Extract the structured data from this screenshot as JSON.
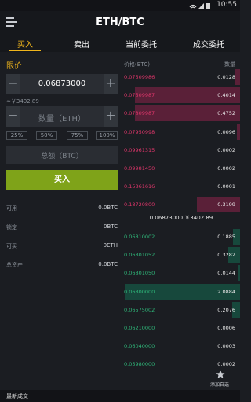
{
  "status": {
    "time": "10:55"
  },
  "header": {
    "title": "ETH/BTC"
  },
  "tabs": [
    {
      "label": "买入",
      "active": true
    },
    {
      "label": "卖出",
      "active": false
    },
    {
      "label": "当前委托",
      "active": false
    },
    {
      "label": "成交委托",
      "active": false
    }
  ],
  "form": {
    "order_type": "限价",
    "price_value": "0.06873000",
    "price_cny": "≈￥3402.89",
    "amount_placeholder": "数量（ETH）",
    "percent_options": [
      "25%",
      "50%",
      "75%",
      "100%"
    ],
    "total_placeholder": "总额（BTC）",
    "buy_label": "买入"
  },
  "balances": [
    {
      "label": "可用",
      "value": "0.0BTC"
    },
    {
      "label": "锁定",
      "value": "0BTC"
    },
    {
      "label": "可买",
      "value": "0ETH"
    },
    {
      "label": "总资产",
      "value": "0.0BTC"
    }
  ],
  "orderbook": {
    "price_header": "价格(BTC)",
    "qty_header": "数量",
    "asks": [
      {
        "price": "0.07509986",
        "qty": "0.0128",
        "depth": 0.04
      },
      {
        "price": "0.07509987",
        "qty": "0.4014",
        "depth": 0.92
      },
      {
        "price": "0.07809987",
        "qty": "0.4752",
        "depth": 0.92
      },
      {
        "price": "0.07950998",
        "qty": "0.0096",
        "depth": 0.03
      },
      {
        "price": "0.09961315",
        "qty": "0.0002",
        "depth": 0.0
      },
      {
        "price": "0.09981450",
        "qty": "0.0002",
        "depth": 0.0
      },
      {
        "price": "0.15861616",
        "qty": "0.0001",
        "depth": 0.0
      },
      {
        "price": "0.18720800",
        "qty": "0.3199",
        "depth": 0.38
      }
    ],
    "mid": "0.06873000 ￥3402.89",
    "bids": [
      {
        "price": "0.06810002",
        "qty": "0.1885",
        "depth": 0.06
      },
      {
        "price": "0.06801052",
        "qty": "0.3282",
        "depth": 0.1
      },
      {
        "price": "0.06801050",
        "qty": "0.0144",
        "depth": 0.02
      },
      {
        "price": "0.06800000",
        "qty": "2.0884",
        "depth": 1.0
      },
      {
        "price": "0.06575002",
        "qty": "0.2076",
        "depth": 0.07
      },
      {
        "price": "0.06210000",
        "qty": "0.0006",
        "depth": 0.0
      },
      {
        "price": "0.06040000",
        "qty": "0.0003",
        "depth": 0.0
      },
      {
        "price": "0.05980000",
        "qty": "0.0002",
        "depth": 0.0
      }
    ]
  },
  "footer": {
    "latest_trades": "最新成交",
    "favorite_label": "添加自选"
  },
  "colors": {
    "accent": "#f0b51c",
    "buy": "#7fa319",
    "ask": "#e0366b",
    "bid": "#2fb87a"
  }
}
